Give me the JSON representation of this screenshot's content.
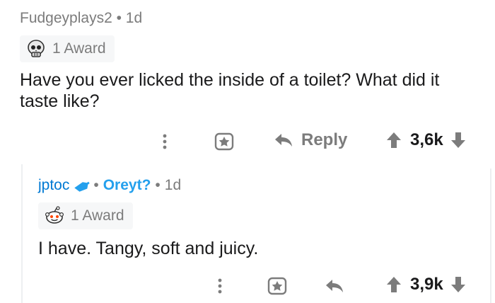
{
  "comment1": {
    "username": "Fudgeyplays2",
    "separator": "•",
    "time": "1d",
    "award_label": "1 Award",
    "body": "Have you ever licked the inside of a toilet? What did it taste like?",
    "reply_label": "Reply",
    "score": "3,6k",
    "award_icon": "skull-award-icon"
  },
  "comment2": {
    "username": "jptoc",
    "separator": "•",
    "flair": "Oreyt?",
    "separator2": "•",
    "time": "1d",
    "award_label": "1 Award",
    "body": "I have. Tangy, soft and juicy.",
    "score": "3,9k",
    "award_icon": "snoo-award-icon"
  },
  "colors": {
    "username_blue": "#0079d3",
    "flair_blue": "#24a0ed",
    "meta_gray": "#7c7c7c",
    "award_bg": "#f6f7f8"
  }
}
